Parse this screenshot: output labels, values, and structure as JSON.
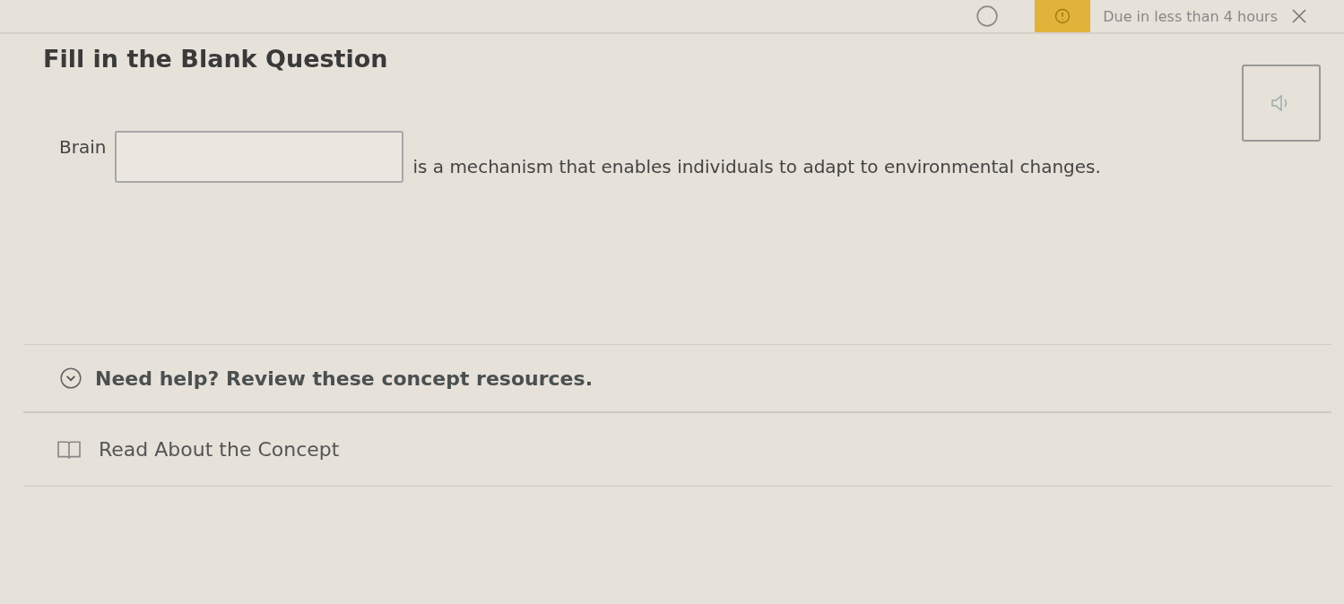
{
  "header": {
    "due_notice": "Due in less than 4 hours"
  },
  "title": "Fill in the Blank Question",
  "question": {
    "before": "Brain",
    "after": "is a mechanism that enables individuals to adapt to environmental changes."
  },
  "help": {
    "label": "Need help? Review these concept resources.",
    "expanded": true,
    "resources": [
      {
        "label": "Read About the Concept"
      }
    ]
  }
}
